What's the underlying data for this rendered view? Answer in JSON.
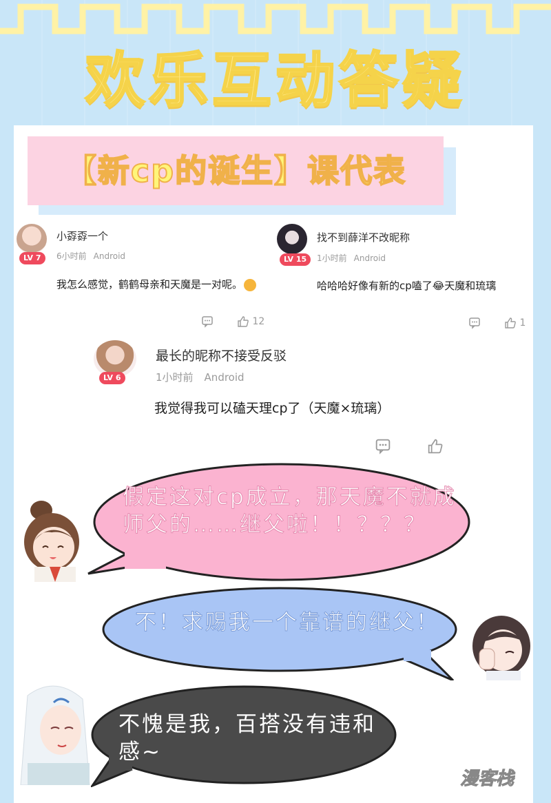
{
  "header": {
    "title": "欢乐互动答疑"
  },
  "topic_tag": {
    "text": "【新cp的诞生】课代表"
  },
  "comments": [
    {
      "name": "小孬孬一个",
      "level": "LV 7",
      "time": "6小时前",
      "device": "Android",
      "text": "我怎么感觉，鹤鹤母亲和天魔是一对呢。",
      "like_count": "12"
    },
    {
      "name": "找不到薛洋不改昵称",
      "level": "LV 15",
      "time": "1小时前",
      "device": "Android",
      "text": "哈哈哈好像有新的cp嗑了😂天魔和琉璃",
      "like_count": "1"
    },
    {
      "name": "最长的昵称不接受反驳",
      "level": "LV 6",
      "time": "1小时前",
      "device": "Android",
      "text": "我觉得我可以磕天理cp了（天魔×琉璃）",
      "like_count": ""
    }
  ],
  "dialog": [
    {
      "text": "假定这对cp成立，那天魔不就成师父的……继父啦！！？？？",
      "fill": "#fbb3d0",
      "color": "#ffffff"
    },
    {
      "text": "不！求赐我一个靠谱的继父！",
      "fill": "#a9c5f5",
      "color": "#ffffff"
    },
    {
      "text": "不愧是我，百搭没有违和感~",
      "fill": "#4a4a4a",
      "color": "#ffffff"
    }
  ],
  "watermark": "漫客栈",
  "icons": [
    "reply-icon",
    "thumbs-up-icon"
  ]
}
